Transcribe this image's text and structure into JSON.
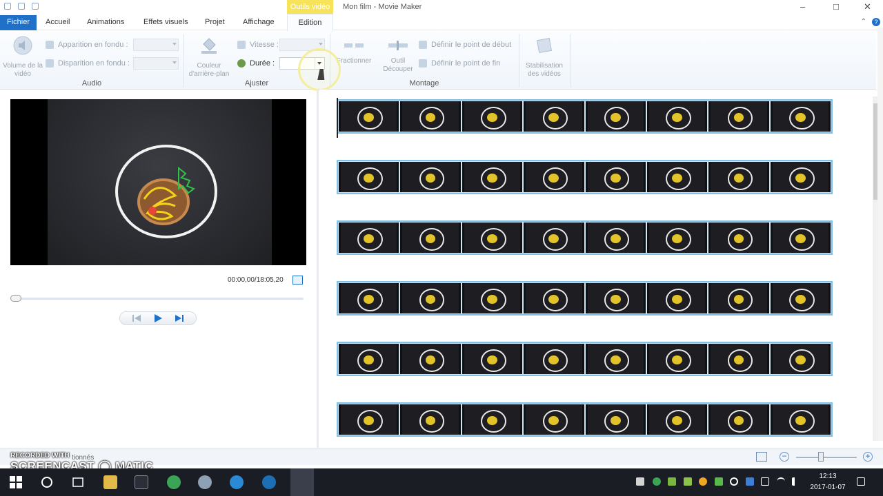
{
  "window": {
    "title": "Mon film - Movie Maker",
    "context_tab_header": "Outils vidéo"
  },
  "tabs": [
    {
      "label": "Fichier"
    },
    {
      "label": "Accueil"
    },
    {
      "label": "Animations"
    },
    {
      "label": "Effets visuels"
    },
    {
      "label": "Projet"
    },
    {
      "label": "Affichage"
    },
    {
      "label": "Edition"
    }
  ],
  "help_glyph": "?",
  "ribbon": {
    "audio": {
      "volume_label": "Volume de la vidéo",
      "fade_in_label": "Apparition en fondu :",
      "fade_out_label": "Disparition en fondu :",
      "group_label": "Audio"
    },
    "adjust": {
      "bgcolor_label": "Couleur d'arrière-plan",
      "speed_label": "Vitesse :",
      "duration_label": "Durée :",
      "group_label": "Ajuster"
    },
    "edit": {
      "split_label": "Fractionner",
      "trim_label": "Outil Découper",
      "set_start_label": "Définir le point de début",
      "set_end_label": "Définir le point de fin",
      "group_label": "Montage"
    },
    "stabilization_label": "Stabilisation des vidéos"
  },
  "preview": {
    "time_readout": "00:00,00/18:05,20",
    "seek_fraction": 0.0
  },
  "storyboard": {
    "rows": 6,
    "frames_per_row": 8
  },
  "status": {
    "text": "tionnés",
    "zoom_fraction": 0.4
  },
  "watermark": {
    "line1": "RECORDED WITH",
    "line2": "SCREENCAST ◯ MATIC"
  },
  "clock": {
    "time": "12:13",
    "date": "2017-01-07"
  }
}
